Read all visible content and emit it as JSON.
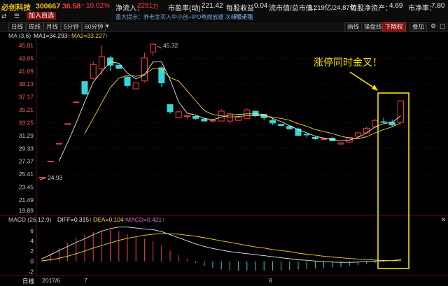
{
  "header": {
    "stock_name": "必创科技",
    "code": "300667",
    "price": "36.58",
    "change_arrow": "↑",
    "change_pct": "10.02%",
    "net_inflow_label": "净流入：",
    "net_inflow_value": "2251",
    "net_inflow_unit": "万",
    "pe_label": "市盈率(动)：",
    "pe_value": "221.42",
    "eps_label": "每股收益",
    "eps_value": "0.04",
    "mktcap_label": "流市值/总市值：",
    "mktcap_value": "6.219亿/24.87亿",
    "bvps_label": "每股净资产：",
    "bvps_value": "4.69",
    "pb_label": "市净率：",
    "pb_value": "7.80"
  },
  "header2": {
    "add_favorite": "加入自选",
    "notice": "重大提示：养老金买入中小创+IPO略微放缓 次新股走强",
    "notice_date": "[08-21]"
  },
  "toolbar": {
    "items": [
      "日线",
      "周线",
      "月线",
      "5分钟",
      "60分钟"
    ],
    "right_buttons": [
      "画线",
      "操盘线",
      "下除权",
      "叠加"
    ],
    "active_right": "下除权"
  },
  "ma_legend": {
    "name": "MA (3,6)",
    "ma1": "MA1=34.293↑",
    "ma2": "MA2=33.227↑"
  },
  "macd_legend": {
    "name": "MACD (26,12,9)",
    "diff": "DIFF=0.315↑",
    "dea": "DEA=0.104↑",
    "macd": "MACD=0.421↑"
  },
  "annotation": {
    "text": "涨停同时金叉！",
    "color": "#f5e000"
  },
  "price_axis": [
    "45.01",
    "43.05",
    "41.09",
    "39.13",
    "37.17",
    "35.21",
    "33.25",
    "31.29",
    "29.33",
    "27.37",
    "25.41",
    "23.45",
    "21.49",
    "19.89"
  ],
  "macd_axis": [
    "6",
    "4",
    "2",
    "0",
    "-2"
  ],
  "x_axis": {
    "period": "日线",
    "labels": [
      "2017/6",
      "7",
      "8"
    ]
  },
  "chart_labels": {
    "high_label": "45.32",
    "low_label": "24.93"
  },
  "chart_data": {
    "type": "candlestick",
    "candles": [
      {
        "o": 24.9,
        "h": 24.93,
        "l": 24.9,
        "c": 24.93
      },
      {
        "o": 27.4,
        "h": 27.4,
        "l": 27.4,
        "c": 27.4
      },
      {
        "o": 30.1,
        "h": 30.1,
        "l": 30.1,
        "c": 30.1
      },
      {
        "o": 33.1,
        "h": 33.1,
        "l": 33.1,
        "c": 33.1
      },
      {
        "o": 36.4,
        "h": 36.4,
        "l": 36.4,
        "c": 36.4
      },
      {
        "o": 39.5,
        "h": 39.6,
        "l": 37.5,
        "c": 37.6
      },
      {
        "o": 40.0,
        "h": 42.6,
        "l": 39.8,
        "c": 42.1
      },
      {
        "o": 41.5,
        "h": 45.0,
        "l": 40.6,
        "c": 43.3
      },
      {
        "o": 43.1,
        "h": 43.4,
        "l": 41.1,
        "c": 42.0
      },
      {
        "o": 42.0,
        "h": 42.0,
        "l": 41.4,
        "c": 41.5
      },
      {
        "o": 40.2,
        "h": 40.3,
        "l": 38.6,
        "c": 38.9
      },
      {
        "o": 38.4,
        "h": 39.4,
        "l": 38.3,
        "c": 39.3
      },
      {
        "o": 39.6,
        "h": 43.9,
        "l": 39.4,
        "c": 43.1
      },
      {
        "o": 44.0,
        "h": 45.32,
        "l": 43.4,
        "c": 45.2
      },
      {
        "o": 41.6,
        "h": 41.8,
        "l": 38.7,
        "c": 39.3
      },
      {
        "o": 36.0,
        "h": 36.0,
        "l": 34.6,
        "c": 34.9
      },
      {
        "o": 34.0,
        "h": 35.0,
        "l": 34.0,
        "c": 34.9
      },
      {
        "o": 34.2,
        "h": 34.3,
        "l": 33.8,
        "c": 34.3
      },
      {
        "o": 34.2,
        "h": 34.4,
        "l": 33.7,
        "c": 33.9
      },
      {
        "o": 33.8,
        "h": 33.9,
        "l": 33.4,
        "c": 33.5
      },
      {
        "o": 33.5,
        "h": 33.8,
        "l": 33.3,
        "c": 33.6
      },
      {
        "o": 33.5,
        "h": 35.3,
        "l": 33.5,
        "c": 35.0
      },
      {
        "o": 33.5,
        "h": 34.7,
        "l": 33.0,
        "c": 34.6
      },
      {
        "o": 33.6,
        "h": 34.0,
        "l": 33.6,
        "c": 34.0
      },
      {
        "o": 33.9,
        "h": 35.4,
        "l": 33.9,
        "c": 35.2
      },
      {
        "o": 35.0,
        "h": 35.1,
        "l": 34.1,
        "c": 34.3
      },
      {
        "o": 34.5,
        "h": 34.6,
        "l": 33.6,
        "c": 34.0
      },
      {
        "o": 33.6,
        "h": 33.9,
        "l": 32.9,
        "c": 33.2
      },
      {
        "o": 33.0,
        "h": 33.1,
        "l": 32.7,
        "c": 32.8
      },
      {
        "o": 32.7,
        "h": 32.9,
        "l": 32.2,
        "c": 32.3
      },
      {
        "o": 32.3,
        "h": 32.5,
        "l": 31.2,
        "c": 31.3
      },
      {
        "o": 31.5,
        "h": 31.6,
        "l": 31.0,
        "c": 31.4
      },
      {
        "o": 31.0,
        "h": 31.2,
        "l": 30.6,
        "c": 30.8
      },
      {
        "o": 30.8,
        "h": 31.0,
        "l": 30.6,
        "c": 30.8
      },
      {
        "o": 30.9,
        "h": 31.1,
        "l": 30.4,
        "c": 30.5
      },
      {
        "o": 30.0,
        "h": 30.3,
        "l": 29.9,
        "c": 30.2
      },
      {
        "o": 30.3,
        "h": 31.1,
        "l": 30.2,
        "c": 31.0
      },
      {
        "o": 31.2,
        "h": 31.9,
        "l": 31.0,
        "c": 31.7
      },
      {
        "o": 31.7,
        "h": 32.6,
        "l": 31.6,
        "c": 32.4
      },
      {
        "o": 32.6,
        "h": 33.8,
        "l": 32.4,
        "c": 33.6
      },
      {
        "o": 33.4,
        "h": 34.0,
        "l": 33.2,
        "c": 33.3
      },
      {
        "o": 33.3,
        "h": 33.7,
        "l": 32.6,
        "c": 32.9
      },
      {
        "o": 33.3,
        "h": 36.6,
        "l": 33.2,
        "c": 36.58
      }
    ],
    "ma1": [
      null,
      null,
      27.4,
      30.2,
      33.2,
      36.4,
      39.4,
      41.0,
      42.5,
      42.3,
      40.8,
      39.9,
      40.5,
      42.5,
      42.5,
      39.8,
      36.4,
      34.7,
      34.4,
      33.9,
      33.7,
      34.1,
      34.4,
      34.5,
      34.6,
      34.6,
      34.5,
      33.9,
      33.4,
      32.8,
      32.2,
      31.7,
      31.2,
      30.9,
      30.7,
      30.5,
      30.6,
      31.0,
      31.7,
      32.6,
      33.1,
      33.3,
      34.3
    ],
    "ma2": [
      null,
      null,
      null,
      null,
      null,
      31.6,
      33.9,
      36.3,
      38.6,
      40.0,
      40.5,
      40.3,
      40.6,
      41.5,
      41.4,
      40.1,
      39.6,
      38.1,
      36.6,
      35.1,
      34.5,
      34.3,
      34.1,
      34.2,
      34.3,
      34.3,
      34.3,
      34.1,
      33.9,
      33.6,
      33.1,
      32.7,
      32.2,
      31.9,
      31.6,
      31.2,
      30.9,
      30.8,
      31.1,
      31.7,
      32.2,
      32.6,
      33.2
    ],
    "macd_hist": [
      0.6,
      1.6,
      2.6,
      3.6,
      4.6,
      5.2,
      5.8,
      6.1,
      6.1,
      5.9,
      5.3,
      4.7,
      4.4,
      4.0,
      3.1,
      2.1,
      1.2,
      0.4,
      -0.3,
      -0.9,
      -1.3,
      -1.6,
      -1.7,
      -1.8,
      -1.8,
      -1.8,
      -1.8,
      -1.8,
      -1.7,
      -1.7,
      -1.6,
      -1.5,
      -1.4,
      -1.3,
      -1.2,
      -1.1,
      -0.9,
      -0.7,
      -0.5,
      -0.3,
      -0.2,
      -0.1,
      0.42
    ],
    "diff": [
      0.5,
      1.3,
      2.1,
      2.9,
      3.7,
      4.4,
      5.2,
      5.9,
      6.4,
      6.7,
      6.7,
      6.5,
      6.3,
      6.2,
      5.8,
      5.2,
      4.6,
      4.0,
      3.4,
      2.9,
      2.5,
      2.2,
      1.9,
      1.7,
      1.5,
      1.3,
      1.1,
      0.9,
      0.7,
      0.5,
      0.3,
      0.2,
      0.05,
      -0.05,
      -0.15,
      -0.2,
      -0.2,
      -0.15,
      -0.05,
      0.05,
      0.1,
      0.15,
      0.315
    ],
    "dea": [
      0.1,
      0.3,
      0.6,
      1.0,
      1.5,
      2.0,
      2.6,
      3.1,
      3.6,
      4.1,
      4.5,
      4.8,
      5.1,
      5.3,
      5.4,
      5.4,
      5.3,
      5.1,
      4.9,
      4.6,
      4.3,
      4.0,
      3.7,
      3.4,
      3.1,
      2.8,
      2.6,
      2.3,
      2.1,
      1.9,
      1.6,
      1.4,
      1.2,
      1.0,
      0.85,
      0.7,
      0.55,
      0.45,
      0.35,
      0.25,
      0.18,
      0.12,
      0.104
    ],
    "price_range": [
      19.89,
      45.32
    ],
    "macd_range": [
      -2.5,
      7.2
    ]
  }
}
